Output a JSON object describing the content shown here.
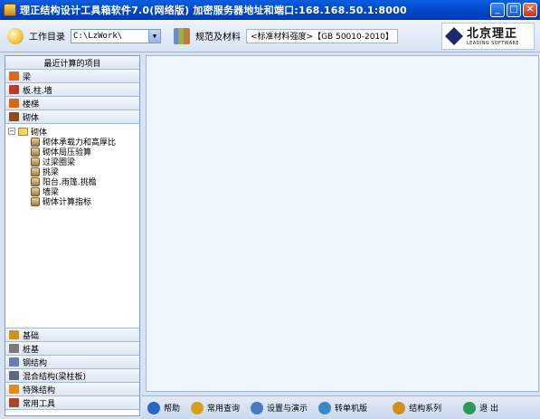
{
  "window": {
    "title": "理正结构设计工具箱软件7.0(网络版)  加密服务器地址和端口:168.168.50.1:8000",
    "minimize": "_",
    "maximize": "□",
    "close": "✕"
  },
  "toolbar": {
    "workdir_label": "工作目录",
    "workdir_value": "C:\\LzWork\\",
    "workdir_arrow": "▼",
    "spec_label": "规范及材料",
    "spec_value": "<标准材料强度>【GB 50010-2010】",
    "logo_cn": "北京理正",
    "logo_en": "LEADING SOFTWARE"
  },
  "sidebar": {
    "recent": "最近计算的项目",
    "top_categories": [
      {
        "label": "梁",
        "color": "#d26a2a"
      },
      {
        "label": "板.柱.墙",
        "color": "#c0392b"
      },
      {
        "label": "楼梯",
        "color": "#d4691c"
      },
      {
        "label": "砌体",
        "color": "#8e4a1c"
      }
    ],
    "tree_root": "砌体",
    "tree_expander": "−",
    "tree_items": [
      "砌体承载力和高厚比",
      "砌体局压验算",
      "过梁圈梁",
      "挑梁",
      "阳台.雨篷.挑檐",
      "墙梁",
      "砌体计算指标"
    ],
    "bottom_categories": [
      {
        "label": "基础",
        "color": "#c8961c"
      },
      {
        "label": "桩基",
        "color": "#7a7a7a"
      },
      {
        "label": "钢结构",
        "color": "#6a7ea8"
      },
      {
        "label": "混合结构(梁柱板)",
        "color": "#5a6a7a"
      },
      {
        "label": "特殊结构",
        "color": "#e08a1a"
      },
      {
        "label": "常用工具",
        "color": "#a04a2a"
      }
    ]
  },
  "bottombar": [
    {
      "label": "帮助",
      "color": "#2a66c8"
    },
    {
      "label": "常用查询",
      "color": "#d9a020"
    },
    {
      "label": "设置与演示",
      "color": "#4a7ac0"
    },
    {
      "label": "转单机版",
      "color": "#3a8ac8"
    },
    {
      "label": "结构系列",
      "color": "#d0901a"
    },
    {
      "label": "退 出",
      "color": "#2a9a5a"
    }
  ]
}
